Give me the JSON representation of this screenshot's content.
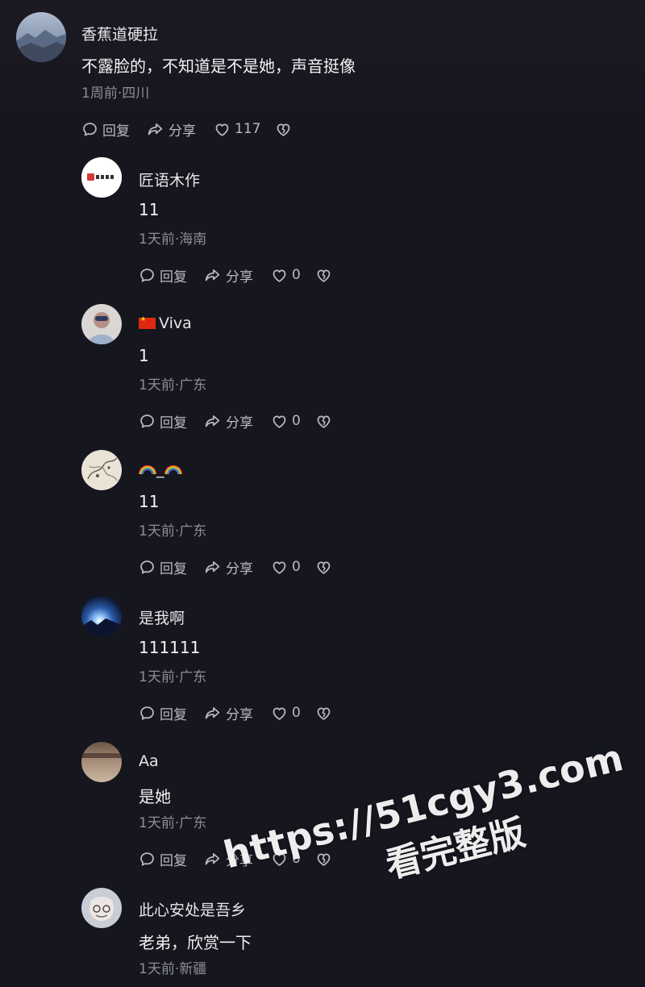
{
  "comments": [
    {
      "author": "香蕉道硬拉",
      "content": "不露脸的，不知道是不是她，声音挺像",
      "meta": "1周前·四川",
      "reply_label": "回复",
      "share_label": "分享",
      "like_count": "117"
    },
    {
      "author": "匠语木作",
      "content": "11",
      "meta": "1天前·海南",
      "reply_label": "回复",
      "share_label": "分享",
      "like_count": "0",
      "avatar_logo_text": "匠语木作"
    },
    {
      "author": "Viva",
      "content": "1",
      "meta": "1天前·广东",
      "reply_label": "回复",
      "share_label": "分享",
      "like_count": "0"
    },
    {
      "author": "_",
      "content": "11",
      "meta": "1天前·广东",
      "reply_label": "回复",
      "share_label": "分享",
      "like_count": "0"
    },
    {
      "author": "是我啊",
      "content": "111111",
      "meta": "1天前·广东",
      "reply_label": "回复",
      "share_label": "分享",
      "like_count": "0"
    },
    {
      "author": "Aa",
      "content": "是她",
      "meta": "1天前·广东",
      "reply_label": "回复",
      "share_label": "分享",
      "like_count": "0"
    },
    {
      "author": "此心安处是吾乡",
      "content": "老弟，欣赏一下",
      "meta": "1天前·新疆"
    }
  ],
  "watermark": {
    "url": "https://51cgy3.com",
    "caption": "看完整版"
  },
  "icons": {
    "reply": "comment-bubble-icon",
    "share": "share-arrow-icon",
    "like": "heart-outline-icon",
    "dislike": "broken-heart-icon",
    "flag": "china-flag-icon",
    "rainbow": "rainbow-emoji-icon"
  },
  "colors": {
    "background": "#16161e",
    "text_primary": "#ececec",
    "text_meta": "#8d8d96",
    "action_gray": "#b9b9c2"
  }
}
